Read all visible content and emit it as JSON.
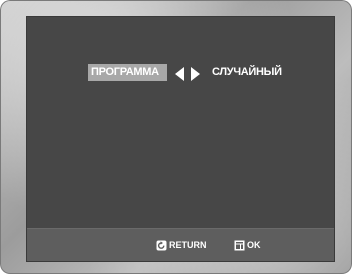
{
  "menu": {
    "selected_label": "ПРОГРАММА",
    "value_label": "СЛУЧАЙНЫЙ",
    "left_arrow_icon": "left-arrow-icon",
    "right_arrow_icon": "right-arrow-icon"
  },
  "footer": {
    "return_label": "RETURN",
    "return_icon": "return-icon",
    "ok_label": "OK",
    "ok_icon": "enter-icon"
  },
  "colors": {
    "screen_background": "#474747",
    "selected_highlight": "#a8a8a8",
    "footer_background": "#5e5e5e",
    "text": "#ffffff"
  }
}
